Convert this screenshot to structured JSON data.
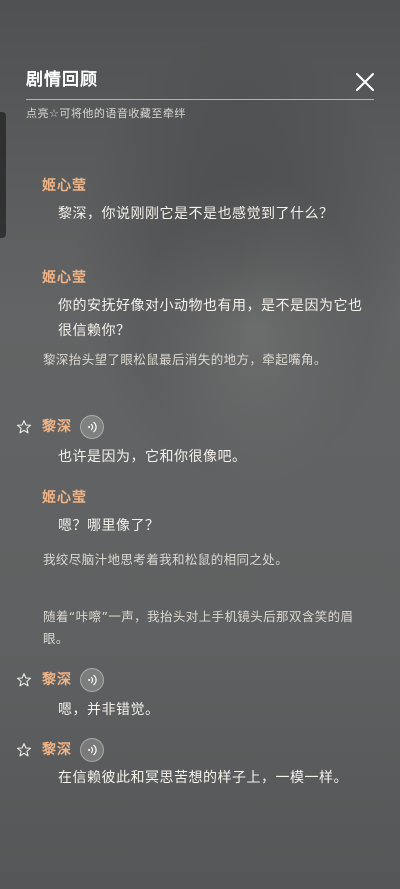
{
  "header": {
    "title": "剧情回顾",
    "subtitle": "点亮☆可将他的语音收藏至牵绊"
  },
  "entries": [
    {
      "speaker": "姬心莹",
      "text": "黎深，你说刚刚它是不是也感觉到了什么？"
    },
    {
      "speaker": "姬心莹",
      "text": "你的安抚好像对小动物也有用，是不是因为它也很信赖你？"
    },
    {
      "narration": "黎深抬头望了眼松鼠最后消失的地方，牵起嘴角。"
    },
    {
      "speaker": "黎深",
      "text": "也许是因为，它和你很像吧。"
    },
    {
      "speaker": "姬心莹",
      "text": "嗯？哪里像了？"
    },
    {
      "narration": "我绞尽脑汁地思考着我和松鼠的相同之处。"
    },
    {
      "narration": "随着“咔嚓”一声，我抬头对上手机镜头后那双含笑的眉眼。"
    },
    {
      "speaker": "黎深",
      "text": "嗯，并非错觉。"
    },
    {
      "speaker": "黎深",
      "text": "在信赖彼此和冥思苦想的样子上，一模一样。"
    }
  ],
  "icons": {
    "close": "close-icon",
    "favorite": "star-outline-icon",
    "voice": "voice-play-icon"
  },
  "colors": {
    "speaker_name": "#f0b487",
    "dialog_text": "#f5f2ec",
    "narration_text": "#dcd8d1"
  }
}
